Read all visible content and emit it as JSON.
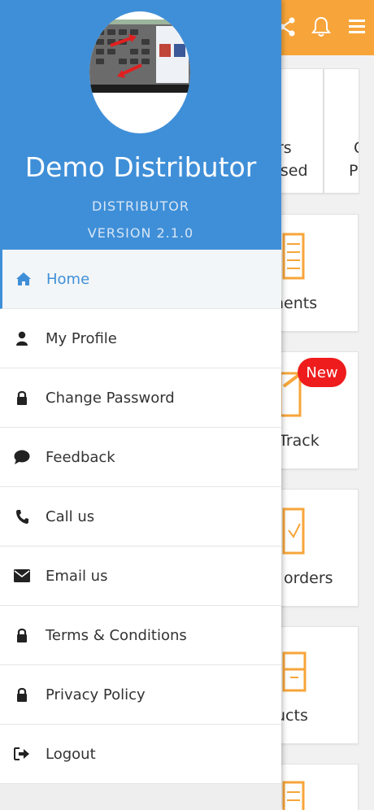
{
  "drawer": {
    "profile_name": "Demo Distributor",
    "role": "DISTRIBUTOR",
    "version": "VERSION 2.1.0",
    "menu": [
      {
        "label": "Home",
        "icon": "home-icon",
        "active": true
      },
      {
        "label": "My Profile",
        "icon": "user-icon"
      },
      {
        "label": "Change Password",
        "icon": "lock-icon"
      },
      {
        "label": "Feedback",
        "icon": "comment-icon"
      },
      {
        "label": "Call us",
        "icon": "phone-icon"
      },
      {
        "label": "Email us",
        "icon": "envelope-icon"
      },
      {
        "label": "Terms & Conditions",
        "icon": "lock-icon"
      },
      {
        "label": "Privacy Policy",
        "icon": "lock-icon"
      },
      {
        "label": "Logout",
        "icon": "sign-out-icon"
      }
    ]
  },
  "background": {
    "header_color": "#f7a53a",
    "header_icons": [
      "share-icon",
      "bell-icon",
      "menu-icon"
    ],
    "card_row1_col1_line1": "rs",
    "card_row1_col1_line2": "ssed",
    "card_row1_col2_line1": "C",
    "card_row1_col2_line2": "P",
    "card2_label": "nents",
    "card3_label": "Track",
    "card3_badge": "New",
    "card4_label": "orders",
    "card5_label": "ucts"
  },
  "colors": {
    "accent": "#3f8fd8",
    "orange": "#f7a53a",
    "badge_red": "#ee1c1c"
  }
}
